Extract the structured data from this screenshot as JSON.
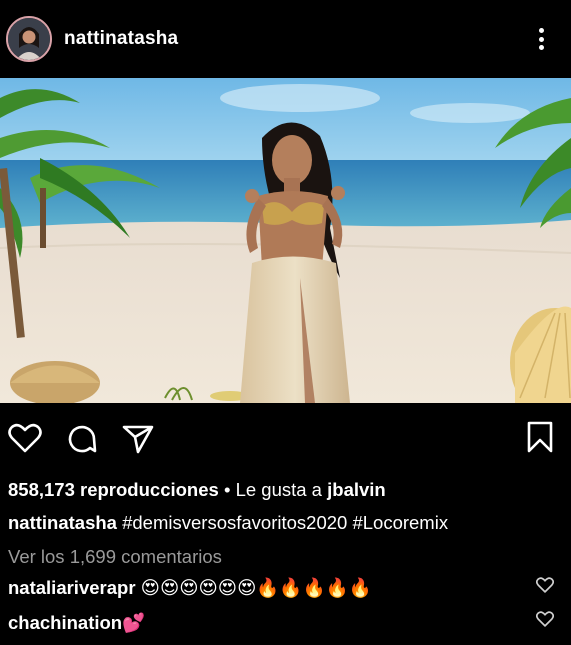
{
  "header": {
    "username": "nattinatasha"
  },
  "stats": {
    "views": "858,173 reproducciones",
    "liked_prefix": " • Le gusta a ",
    "liked_by": "jbalvin"
  },
  "caption": {
    "username": "nattinatasha",
    "text": "#demisversosfavoritos2020 #Locoremix"
  },
  "comments_link": "Ver los 1,699 comentarios",
  "comments": [
    {
      "username": "nataliariverapr",
      "text": "😍😍😍😍😍😍🔥🔥🔥🔥🔥"
    },
    {
      "username": "chachination",
      "text": "💕"
    }
  ],
  "icons": {
    "like": "heart-icon",
    "comment": "comment-icon",
    "share": "send-icon",
    "save": "bookmark-icon",
    "more": "more-vertical-icon"
  }
}
